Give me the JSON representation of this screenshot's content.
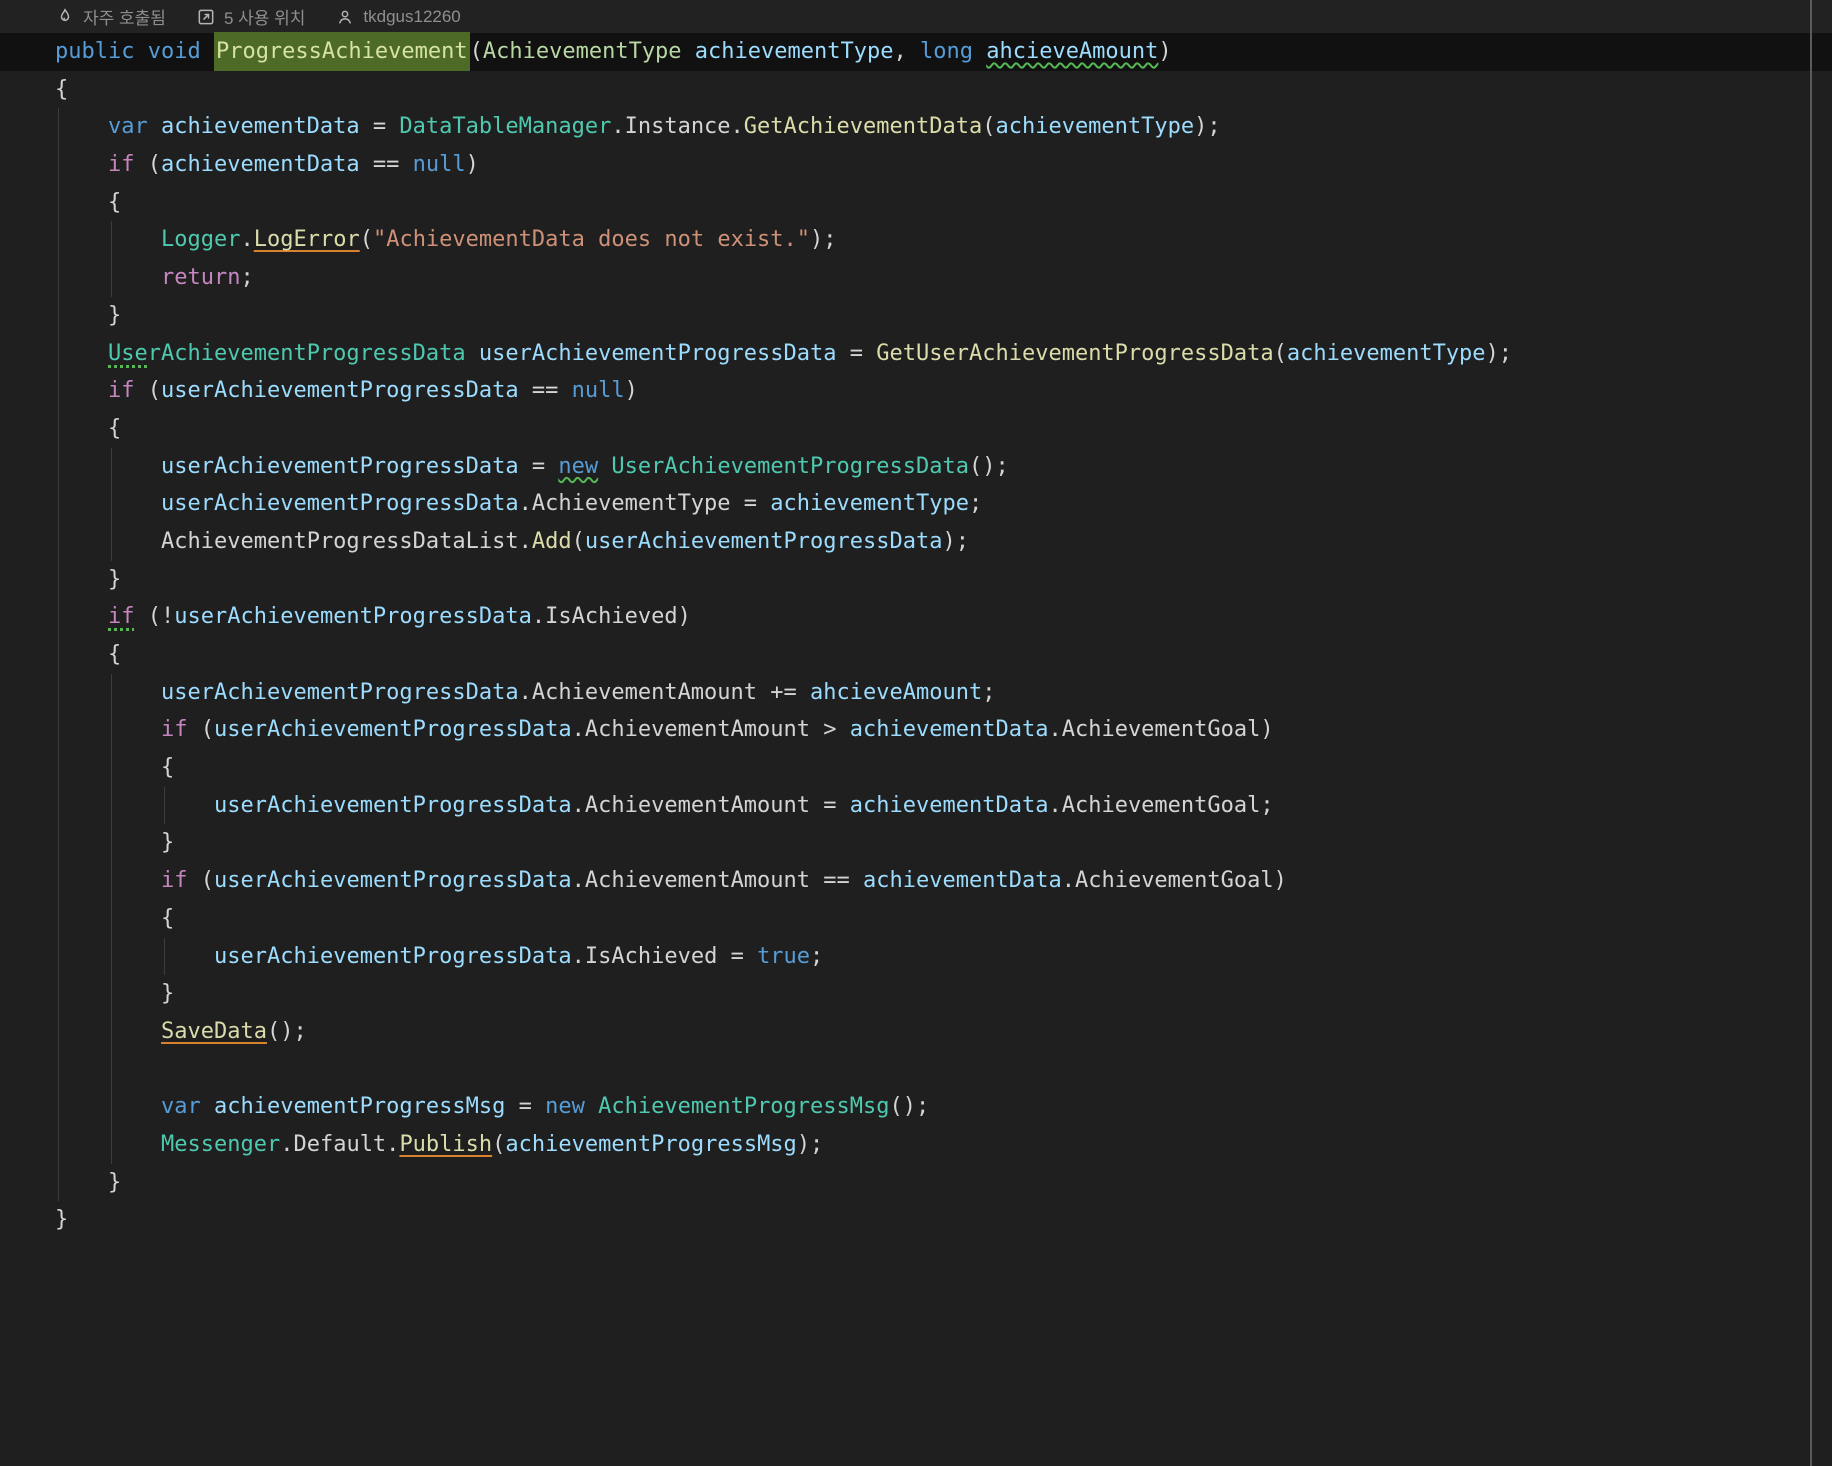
{
  "code_vision": {
    "hot_label": "자주 호출됨",
    "usages_label": "5 사용 위치",
    "author_label": "tkdgus12260"
  },
  "colors": {
    "bg": "#1F1F1F",
    "topbar": "#222222",
    "sticky": "#111111",
    "guide": "#3C3C3C",
    "cvtext": "#8F8F8F",
    "kw": "#569CD6",
    "ctrl": "#C586C0",
    "cls": "#4EC9B0",
    "enum": "#B8D7A3",
    "meth": "#DCDCAA",
    "var": "#9CDCFE",
    "str": "#CE9178",
    "pln": "#D4D4D4",
    "declfg": "#D7E3A0",
    "declbg": "#4D6A26",
    "green": "#55B855",
    "orange": "#D8822E"
  },
  "editor": {
    "language": "csharp",
    "lines": [
      {
        "indent": 0,
        "guides": 0,
        "sticky": true,
        "seg": [
          {
            "c": "kw",
            "t": "public void "
          },
          {
            "c": "decl",
            "t": "ProgressAchievement"
          },
          {
            "c": "pln",
            "t": "("
          },
          {
            "c": "enum",
            "t": "AchievementType"
          },
          {
            "c": "var",
            "t": " achievementType"
          },
          {
            "c": "pln",
            "t": ", "
          },
          {
            "c": "kw",
            "t": "long "
          },
          {
            "c": "var",
            "t": "ahcieveAmount",
            "u": "wavy"
          },
          {
            "c": "pln",
            "t": ")"
          }
        ]
      },
      {
        "indent": 0,
        "guides": 0,
        "seg": [
          {
            "c": "pln",
            "t": "{"
          }
        ]
      },
      {
        "indent": 1,
        "guides": 1,
        "seg": [
          {
            "c": "kw",
            "t": "var "
          },
          {
            "c": "var",
            "t": "achievementData"
          },
          {
            "c": "pln",
            "t": " = "
          },
          {
            "c": "cls",
            "t": "DataTableManager"
          },
          {
            "c": "pln",
            "t": ".Instance."
          },
          {
            "c": "meth",
            "t": "GetAchievementData"
          },
          {
            "c": "pln",
            "t": "("
          },
          {
            "c": "var",
            "t": "achievementType"
          },
          {
            "c": "pln",
            "t": ");"
          }
        ]
      },
      {
        "indent": 1,
        "guides": 1,
        "seg": [
          {
            "c": "ctrl",
            "t": "if"
          },
          {
            "c": "pln",
            "t": " ("
          },
          {
            "c": "var",
            "t": "achievementData"
          },
          {
            "c": "pln",
            "t": " == "
          },
          {
            "c": "kw",
            "t": "null"
          },
          {
            "c": "pln",
            "t": ")"
          }
        ]
      },
      {
        "indent": 1,
        "guides": 1,
        "seg": [
          {
            "c": "pln",
            "t": "{"
          }
        ]
      },
      {
        "indent": 2,
        "guides": 2,
        "seg": [
          {
            "c": "cls",
            "t": "Logger"
          },
          {
            "c": "pln",
            "t": "."
          },
          {
            "c": "meth",
            "t": "LogError",
            "u": "or"
          },
          {
            "c": "pln",
            "t": "("
          },
          {
            "c": "str",
            "t": "\"AchievementData does not exist.\""
          },
          {
            "c": "pln",
            "t": ");"
          }
        ]
      },
      {
        "indent": 2,
        "guides": 2,
        "seg": [
          {
            "c": "ctrl",
            "t": "return"
          },
          {
            "c": "pln",
            "t": ";"
          }
        ]
      },
      {
        "indent": 1,
        "guides": 1,
        "seg": [
          {
            "c": "pln",
            "t": "}"
          }
        ]
      },
      {
        "indent": 1,
        "guides": 1,
        "seg": [
          {
            "c": "cls",
            "t": "Use",
            "u": "dot"
          },
          {
            "c": "cls",
            "t": "rAchievementProgressData"
          },
          {
            "c": "pln",
            "t": " "
          },
          {
            "c": "var",
            "t": "userAchievementProgressData"
          },
          {
            "c": "pln",
            "t": " = "
          },
          {
            "c": "meth",
            "t": "GetUserAchievementProgressData"
          },
          {
            "c": "pln",
            "t": "("
          },
          {
            "c": "var",
            "t": "achievementType"
          },
          {
            "c": "pln",
            "t": ");"
          }
        ]
      },
      {
        "indent": 1,
        "guides": 1,
        "seg": [
          {
            "c": "ctrl",
            "t": "if"
          },
          {
            "c": "pln",
            "t": " ("
          },
          {
            "c": "var",
            "t": "userAchievementProgressData"
          },
          {
            "c": "pln",
            "t": " == "
          },
          {
            "c": "kw",
            "t": "null"
          },
          {
            "c": "pln",
            "t": ")"
          }
        ]
      },
      {
        "indent": 1,
        "guides": 1,
        "seg": [
          {
            "c": "pln",
            "t": "{"
          }
        ]
      },
      {
        "indent": 2,
        "guides": 2,
        "seg": [
          {
            "c": "var",
            "t": "userAchievementProgressData"
          },
          {
            "c": "pln",
            "t": " = "
          },
          {
            "c": "kw",
            "t": "new",
            "u": "wavy"
          },
          {
            "c": "pln",
            "t": " "
          },
          {
            "c": "cls",
            "t": "UserAchievementProgressData"
          },
          {
            "c": "pln",
            "t": "();"
          }
        ]
      },
      {
        "indent": 2,
        "guides": 2,
        "seg": [
          {
            "c": "var",
            "t": "userAchievementProgressData"
          },
          {
            "c": "pln",
            "t": ".AchievementType = "
          },
          {
            "c": "var",
            "t": "achievementType"
          },
          {
            "c": "pln",
            "t": ";"
          }
        ]
      },
      {
        "indent": 2,
        "guides": 2,
        "seg": [
          {
            "c": "pln",
            "t": "AchievementProgressDataList."
          },
          {
            "c": "meth",
            "t": "Add"
          },
          {
            "c": "pln",
            "t": "("
          },
          {
            "c": "var",
            "t": "userAchievementProgressData"
          },
          {
            "c": "pln",
            "t": ");"
          }
        ]
      },
      {
        "indent": 1,
        "guides": 1,
        "seg": [
          {
            "c": "pln",
            "t": "}"
          }
        ]
      },
      {
        "indent": 1,
        "guides": 1,
        "seg": [
          {
            "c": "ctrl",
            "t": "if",
            "u": "dot"
          },
          {
            "c": "pln",
            "t": " (!"
          },
          {
            "c": "var",
            "t": "userAchievementProgressData"
          },
          {
            "c": "pln",
            "t": ".IsAchieved)"
          }
        ]
      },
      {
        "indent": 1,
        "guides": 1,
        "seg": [
          {
            "c": "pln",
            "t": "{"
          }
        ]
      },
      {
        "indent": 2,
        "guides": 2,
        "seg": [
          {
            "c": "var",
            "t": "userAchievementProgressData"
          },
          {
            "c": "pln",
            "t": ".AchievementAmount += "
          },
          {
            "c": "var",
            "t": "ahcieveAmount"
          },
          {
            "c": "pln",
            "t": ";"
          }
        ]
      },
      {
        "indent": 2,
        "guides": 2,
        "seg": [
          {
            "c": "ctrl",
            "t": "if"
          },
          {
            "c": "pln",
            "t": " ("
          },
          {
            "c": "var",
            "t": "userAchievementProgressData"
          },
          {
            "c": "pln",
            "t": ".AchievementAmount > "
          },
          {
            "c": "var",
            "t": "achievementData"
          },
          {
            "c": "pln",
            "t": ".AchievementGoal)"
          }
        ]
      },
      {
        "indent": 2,
        "guides": 2,
        "seg": [
          {
            "c": "pln",
            "t": "{"
          }
        ]
      },
      {
        "indent": 3,
        "guides": 3,
        "seg": [
          {
            "c": "var",
            "t": "userAchievementProgressData"
          },
          {
            "c": "pln",
            "t": ".AchievementAmount = "
          },
          {
            "c": "var",
            "t": "achievementData"
          },
          {
            "c": "pln",
            "t": ".AchievementGoal;"
          }
        ]
      },
      {
        "indent": 2,
        "guides": 2,
        "seg": [
          {
            "c": "pln",
            "t": "}"
          }
        ]
      },
      {
        "indent": 2,
        "guides": 2,
        "seg": [
          {
            "c": "ctrl",
            "t": "if"
          },
          {
            "c": "pln",
            "t": " ("
          },
          {
            "c": "var",
            "t": "userAchievementProgressData"
          },
          {
            "c": "pln",
            "t": ".AchievementAmount == "
          },
          {
            "c": "var",
            "t": "achievementData"
          },
          {
            "c": "pln",
            "t": ".AchievementGoal)"
          }
        ]
      },
      {
        "indent": 2,
        "guides": 2,
        "seg": [
          {
            "c": "pln",
            "t": "{"
          }
        ]
      },
      {
        "indent": 3,
        "guides": 3,
        "seg": [
          {
            "c": "var",
            "t": "userAchievementProgressData"
          },
          {
            "c": "pln",
            "t": ".IsAchieved = "
          },
          {
            "c": "kw",
            "t": "true"
          },
          {
            "c": "pln",
            "t": ";"
          }
        ]
      },
      {
        "indent": 2,
        "guides": 2,
        "seg": [
          {
            "c": "pln",
            "t": "}"
          }
        ]
      },
      {
        "indent": 2,
        "guides": 2,
        "seg": [
          {
            "c": "meth",
            "t": "SaveData",
            "u": "or"
          },
          {
            "c": "pln",
            "t": "();"
          }
        ]
      },
      {
        "indent": 2,
        "guides": 2,
        "seg": []
      },
      {
        "indent": 2,
        "guides": 2,
        "seg": [
          {
            "c": "kw",
            "t": "var "
          },
          {
            "c": "var",
            "t": "achievementProgressMsg"
          },
          {
            "c": "pln",
            "t": " = "
          },
          {
            "c": "kw",
            "t": "new "
          },
          {
            "c": "cls",
            "t": "AchievementProgressMsg"
          },
          {
            "c": "pln",
            "t": "();"
          }
        ]
      },
      {
        "indent": 2,
        "guides": 2,
        "seg": [
          {
            "c": "cls",
            "t": "Messenger"
          },
          {
            "c": "pln",
            "t": ".Default."
          },
          {
            "c": "meth",
            "t": "Publish",
            "u": "or"
          },
          {
            "c": "pln",
            "t": "("
          },
          {
            "c": "var",
            "t": "achievementProgressMsg"
          },
          {
            "c": "pln",
            "t": ");"
          }
        ]
      },
      {
        "indent": 1,
        "guides": 1,
        "seg": [
          {
            "c": "pln",
            "t": "}"
          }
        ]
      },
      {
        "indent": 0,
        "guides": 0,
        "seg": [
          {
            "c": "pln",
            "t": "}"
          }
        ]
      }
    ]
  }
}
